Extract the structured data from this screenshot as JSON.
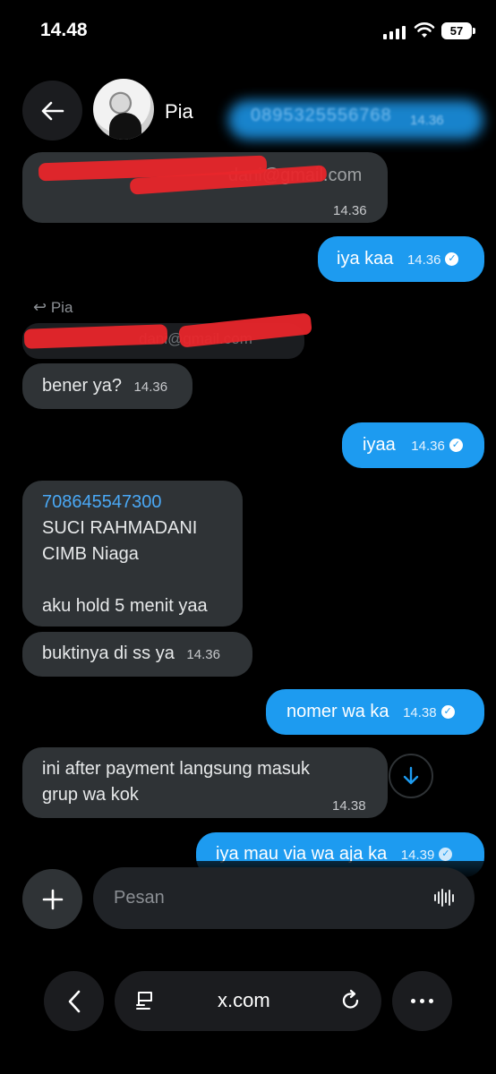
{
  "status_bar": {
    "time": "14.48",
    "battery": "57"
  },
  "header": {
    "contact_name": "Pia",
    "blurred_number": "0895325556768",
    "blurred_time": "14.36"
  },
  "messages": [
    {
      "id": "m1",
      "direction": "incoming",
      "text": "dani@gmail.com",
      "time": "14.36",
      "redacted": true
    },
    {
      "id": "m2",
      "direction": "outgoing",
      "text": "iya kaa",
      "time": "14.36"
    },
    {
      "id": "m3",
      "direction": "incoming",
      "reply_to": "Pia",
      "quoted_text": "dani@gmail.com",
      "text": "bener ya?",
      "time": "14.36"
    },
    {
      "id": "m4",
      "direction": "outgoing",
      "text": "iyaa",
      "time": "14.36"
    },
    {
      "id": "m5",
      "direction": "incoming",
      "account_number": "708645547300",
      "lines": [
        "SUCI RAHMADANI",
        "CIMB Niaga",
        "",
        "aku hold 5 menit yaa"
      ]
    },
    {
      "id": "m6",
      "direction": "incoming",
      "text": "buktinya di ss ya",
      "time": "14.36"
    },
    {
      "id": "m7",
      "direction": "outgoing",
      "text": "nomer wa ka",
      "time": "14.38"
    },
    {
      "id": "m8",
      "direction": "incoming",
      "lines": [
        "ini after payment langsung masuk",
        "grup wa kok"
      ],
      "time": "14.38"
    },
    {
      "id": "m9",
      "direction": "outgoing",
      "text": "iya mau via wa aja ka",
      "time": "14.39"
    }
  ],
  "composer": {
    "placeholder": "Pesan"
  },
  "browser": {
    "url": "x.com"
  },
  "icons": [
    "back-arrow-icon",
    "read-check-icon",
    "reply-icon",
    "chevron-down-icon",
    "plus-icon",
    "voice-wave-icon",
    "chevron-left-icon",
    "reader-icon",
    "reload-icon",
    "more-icon"
  ],
  "colors": {
    "outgoing_bubble": "#1d9bf0",
    "incoming_bubble": "#2f3336",
    "background": "#000000",
    "link": "#4aa8f5",
    "redaction": "#e8262b"
  }
}
